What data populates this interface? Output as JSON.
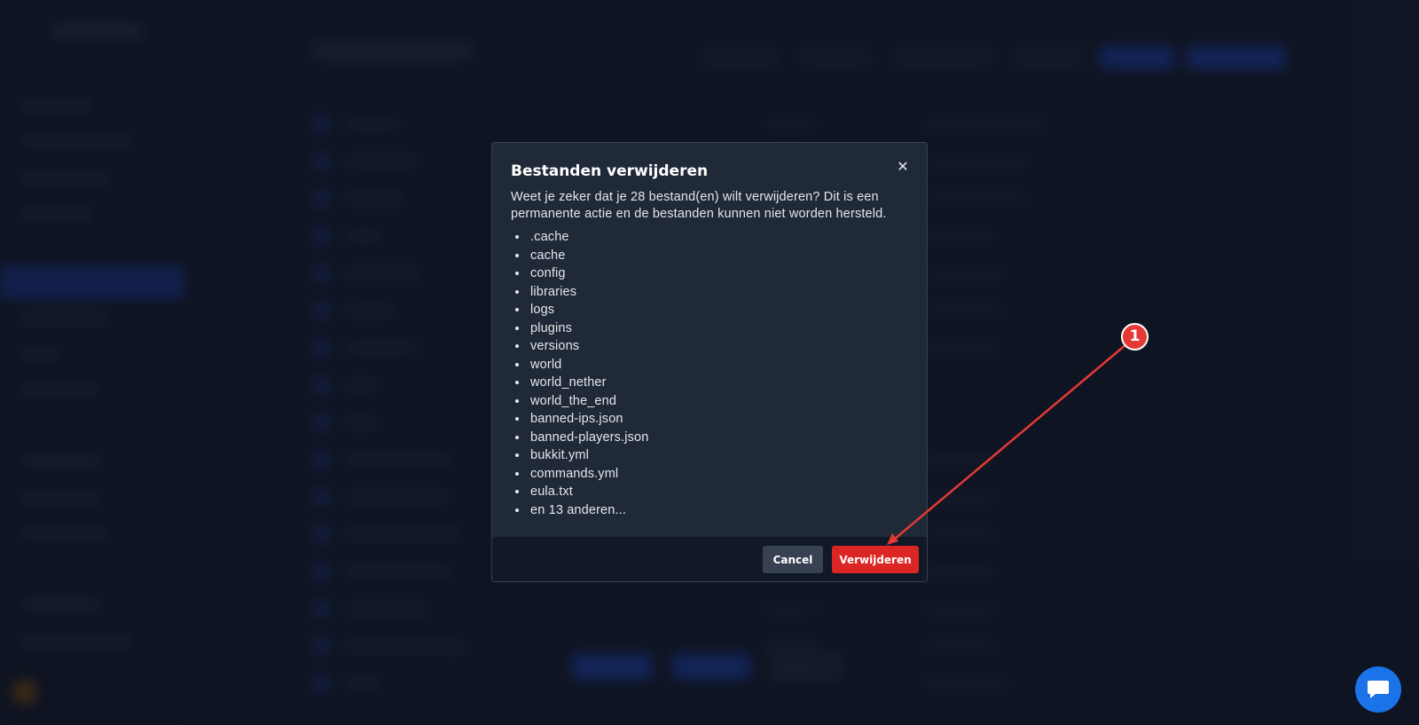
{
  "dialog": {
    "title": "Bestanden verwijderen",
    "message": "Weet je zeker dat je 28 bestand(en) wilt verwijderen? Dit is een permanente actie en de bestanden kunnen niet worden hersteld.",
    "files": [
      ".cache",
      "cache",
      "config",
      "libraries",
      "logs",
      "plugins",
      "versions",
      "world",
      "world_nether",
      "world_the_end",
      "banned-ips.json",
      "banned-players.json",
      "bukkit.yml",
      "commands.yml",
      "eula.txt",
      "en 13 anderen..."
    ],
    "cancel_label": "Cancel",
    "delete_label": "Verwijderen",
    "close_icon": "close-icon"
  },
  "annotation": {
    "badge_label": "1"
  },
  "chat": {
    "icon": "chat-bubble-icon"
  },
  "colors": {
    "danger": "#dc2626",
    "annotation": "#e53935",
    "chat": "#1a73e8"
  }
}
